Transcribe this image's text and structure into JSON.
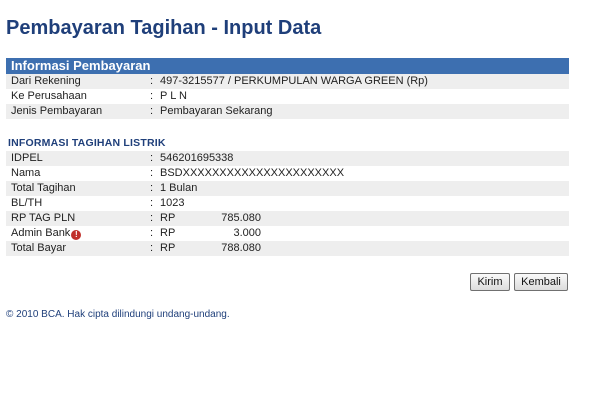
{
  "page": {
    "title": "Pembayaran Tagihan - Input Data"
  },
  "informasi_pembayaran": {
    "header": "Informasi Pembayaran",
    "rows": [
      {
        "label": "Dari Rekening",
        "value": "497-3215577 / PERKUMPULAN WARGA GREEN (Rp)"
      },
      {
        "label": "Ke Perusahaan",
        "value": "P L N"
      },
      {
        "label": "Jenis Pembayaran",
        "value": "Pembayaran Sekarang"
      }
    ]
  },
  "tagihan_listrik": {
    "header": "INFORMASI TAGIHAN LISTRIK",
    "rows": [
      {
        "label": "IDPEL",
        "value": "546201695338"
      },
      {
        "label": "Nama",
        "value": "BSDXXXXXXXXXXXXXXXXXXXXXX"
      },
      {
        "label": "Total Tagihan",
        "value": "1 Bulan"
      },
      {
        "label": "BL/TH",
        "value": "1023"
      }
    ],
    "amounts": [
      {
        "label": "RP TAG PLN",
        "currency": "RP",
        "amount": "785.080"
      },
      {
        "label": "Admin Bank",
        "currency": "RP",
        "amount": "3.000"
      },
      {
        "label": "Total Bayar",
        "currency": "RP",
        "amount": "788.080"
      }
    ],
    "admin_icon": "info-icon",
    "separator": ":"
  },
  "buttons": {
    "kirim": "Kirim",
    "kembali": "Kembali"
  },
  "footer": {
    "text": "©  2010 BCA. Hak cipta dilindungi undang-undang."
  },
  "colors": {
    "title": "#1f3f7a",
    "header_bg": "#3d6fb0",
    "row_shade": "#eeeeee"
  }
}
